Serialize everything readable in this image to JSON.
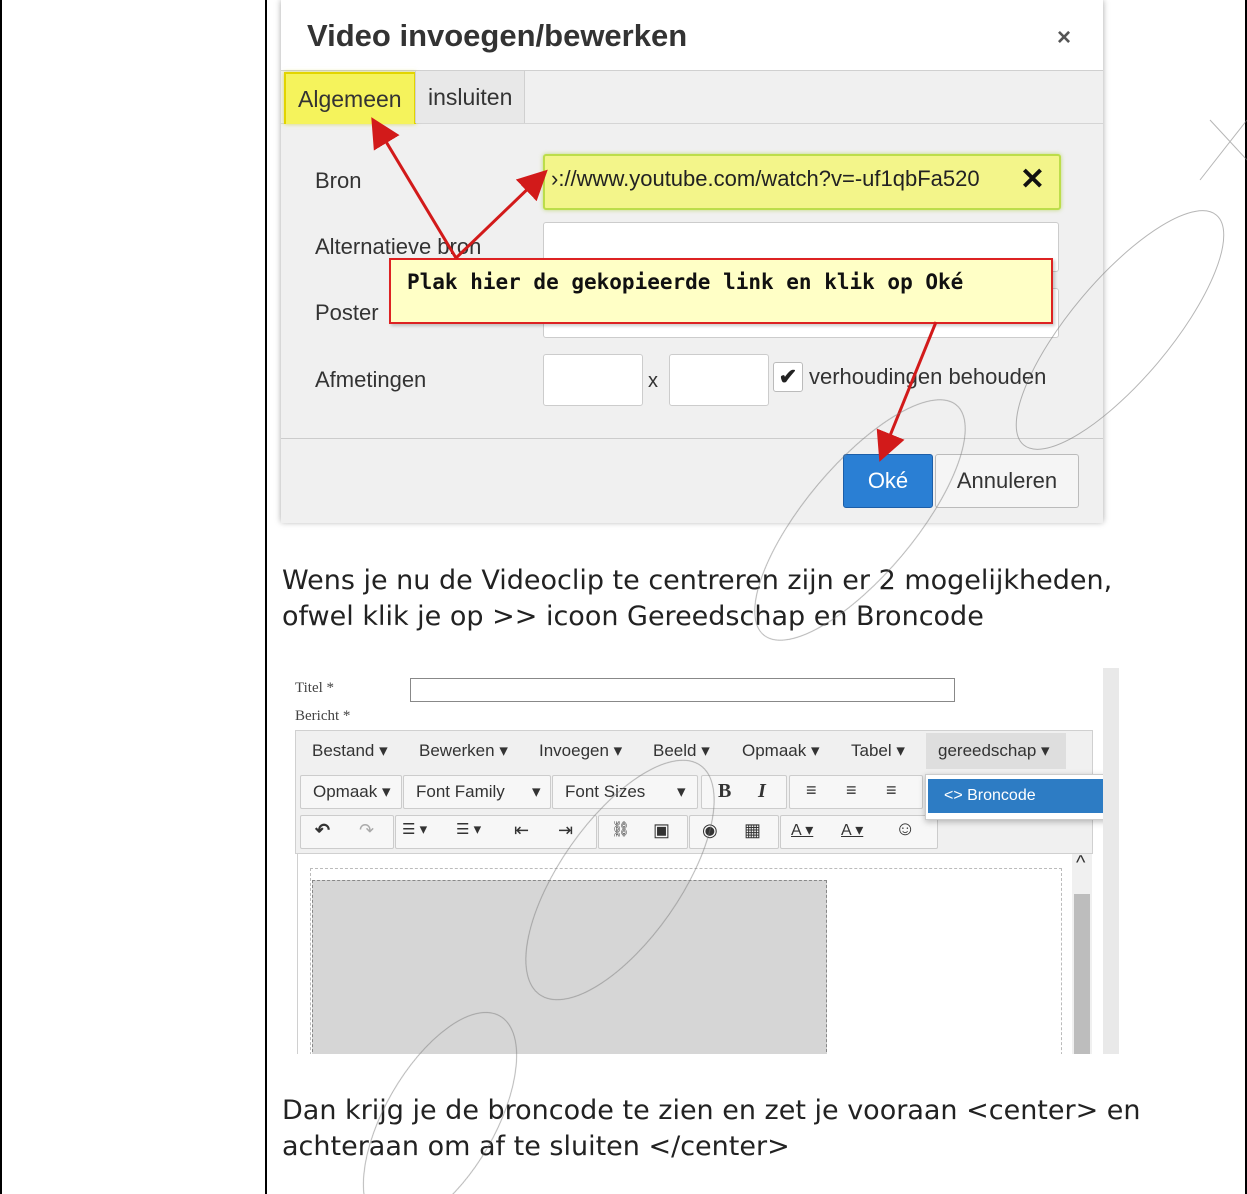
{
  "dialog": {
    "title": "Video invoegen/bewerken",
    "close_icon": "×",
    "tabs": [
      {
        "label": "Algemeen"
      },
      {
        "label": "insluiten"
      }
    ],
    "fields": {
      "bron_label": "Bron",
      "bron_value": "\u0000://www.youtube.com/watch?v=-uf1qbFa520",
      "clear_icon": "✕",
      "alt_label": "Alternatieve bron",
      "poster_label": "Poster",
      "size_label": "Afmetingen",
      "size_x": "x",
      "keep_ratio_label": "verhoudingen behouden",
      "check_mark": "✔"
    },
    "callout": "Plak hier de gekopieerde link en klik op Oké",
    "buttons": {
      "ok": "Oké",
      "cancel": "Annuleren"
    },
    "highlight_color": "#f5f35c",
    "arrow_color": "#d21a1a"
  },
  "paragraphs": {
    "p1_line1": "Wens je nu de Videoclip te centreren zijn er 2 mogelijkheden,",
    "p1_line2": "ofwel klik je op >> icoon Gereedschap en Broncode",
    "p2_line1": "Dan krijg je de broncode te zien en zet je vooraan <center> en",
    "p2_line2": "achteraan om af te sluiten </center>"
  },
  "editor": {
    "title_label": "Titel *",
    "message_label": "Bericht *",
    "menus": [
      "Bestand ▾",
      "Bewerken ▾",
      "Invoegen ▾",
      "Beeld ▾",
      "Opmaak ▾",
      "Tabel ▾",
      "gereedschap ▾"
    ],
    "format_select": "Opmaak ▾",
    "font_family": "Font Family",
    "font_family_caret": "▾",
    "font_sizes": "Font Sizes",
    "font_sizes_caret": "▾",
    "bold": "B",
    "italic": "I",
    "align_left": "≡",
    "align_center": "≡",
    "align_right": "≡",
    "undo": "↶",
    "redo": "↷",
    "bullet_list": "☰ ▾",
    "num_list": "☰ ▾",
    "outdent": "⇤",
    "indent": "⇥",
    "link": "🔗",
    "image": "▣",
    "preview": "◉",
    "media": "▦",
    "text_color": "A ▾",
    "bg_color": "A ▾",
    "emoticon": "☺",
    "dropdown_item": "<> Broncode",
    "scroll_up": "^",
    "accent": "#2d7cc4"
  }
}
